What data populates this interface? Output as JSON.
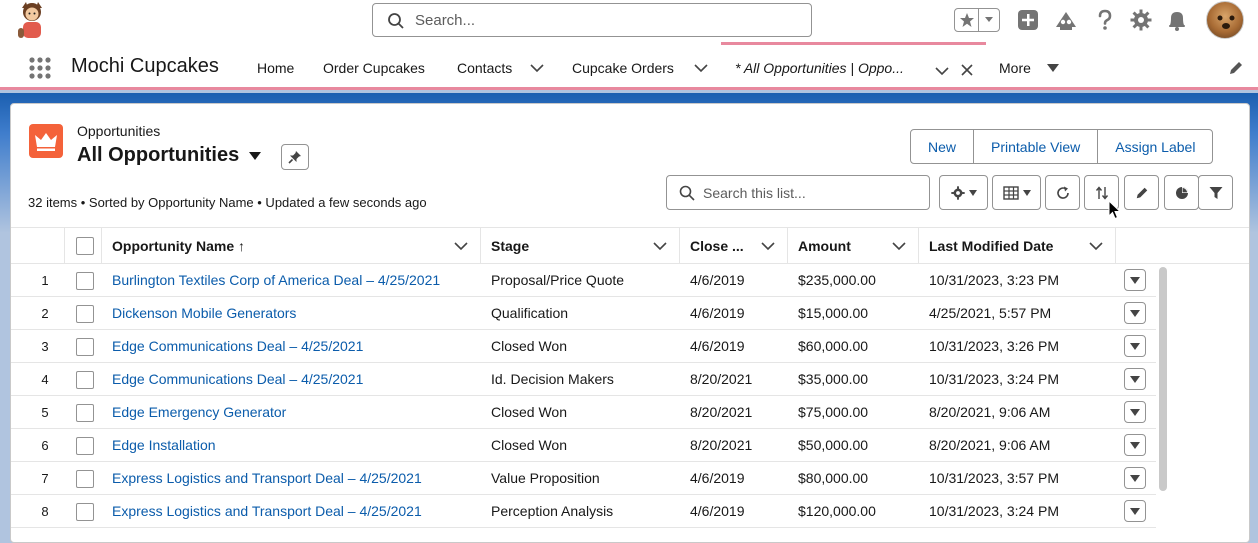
{
  "global_header": {
    "search_placeholder": "Search..."
  },
  "nav": {
    "app_name": "Mochi Cupcakes",
    "items": [
      "Home",
      "Order Cupcakes",
      "Contacts",
      "Cupcake Orders"
    ],
    "active_tab": "* All Opportunities | Oppo...",
    "more_label": "More"
  },
  "list_header": {
    "object_label": "Opportunities",
    "list_title": "All Opportunities",
    "buttons": [
      "New",
      "Printable View",
      "Assign Label"
    ],
    "info": "32 items • Sorted by Opportunity Name • Updated a few seconds ago",
    "search_placeholder": "Search this list..."
  },
  "table": {
    "columns": [
      "Opportunity Name ↑",
      "Stage",
      "Close ...",
      "Amount",
      "Last Modified Date"
    ],
    "rows": [
      {
        "num": "1",
        "name": "Burlington Textiles Corp of America Deal – 4/25/2021",
        "stage": "Proposal/Price Quote",
        "close": "4/6/2019",
        "amount": "$235,000.00",
        "modified": "10/31/2023, 3:23 PM"
      },
      {
        "num": "2",
        "name": "Dickenson Mobile Generators",
        "stage": "Qualification",
        "close": "4/6/2019",
        "amount": "$15,000.00",
        "modified": "4/25/2021, 5:57 PM"
      },
      {
        "num": "3",
        "name": "Edge Communications Deal – 4/25/2021",
        "stage": "Closed Won",
        "close": "4/6/2019",
        "amount": "$60,000.00",
        "modified": "10/31/2023, 3:26 PM"
      },
      {
        "num": "4",
        "name": "Edge Communications Deal – 4/25/2021",
        "stage": "Id. Decision Makers",
        "close": "8/20/2021",
        "amount": "$35,000.00",
        "modified": "10/31/2023, 3:24 PM"
      },
      {
        "num": "5",
        "name": "Edge Emergency Generator",
        "stage": "Closed Won",
        "close": "8/20/2021",
        "amount": "$75,000.00",
        "modified": "8/20/2021, 9:06 AM"
      },
      {
        "num": "6",
        "name": "Edge Installation",
        "stage": "Closed Won",
        "close": "8/20/2021",
        "amount": "$50,000.00",
        "modified": "8/20/2021, 9:06 AM"
      },
      {
        "num": "7",
        "name": "Express Logistics and Transport Deal – 4/25/2021",
        "stage": "Value Proposition",
        "close": "4/6/2019",
        "amount": "$80,000.00",
        "modified": "10/31/2023, 3:57 PM"
      },
      {
        "num": "8",
        "name": "Express Logistics and Transport Deal – 4/25/2021",
        "stage": "Perception Analysis",
        "close": "4/6/2019",
        "amount": "$120,000.00",
        "modified": "10/31/2023, 3:24 PM"
      }
    ]
  },
  "colors": {
    "accent": "#0b5cab",
    "nav_highlight": "#e8899e",
    "object_icon": "#f4623a"
  },
  "icons": [
    "mascot-icon",
    "search-icon",
    "star-icon",
    "plus-icon",
    "trailhead-icon",
    "help-icon",
    "gear-icon",
    "bell-icon",
    "app-launcher-icon",
    "pencil-icon",
    "crown-icon",
    "pin-icon",
    "table-icon",
    "refresh-icon",
    "sort-icon",
    "chart-icon",
    "filter-icon"
  ]
}
